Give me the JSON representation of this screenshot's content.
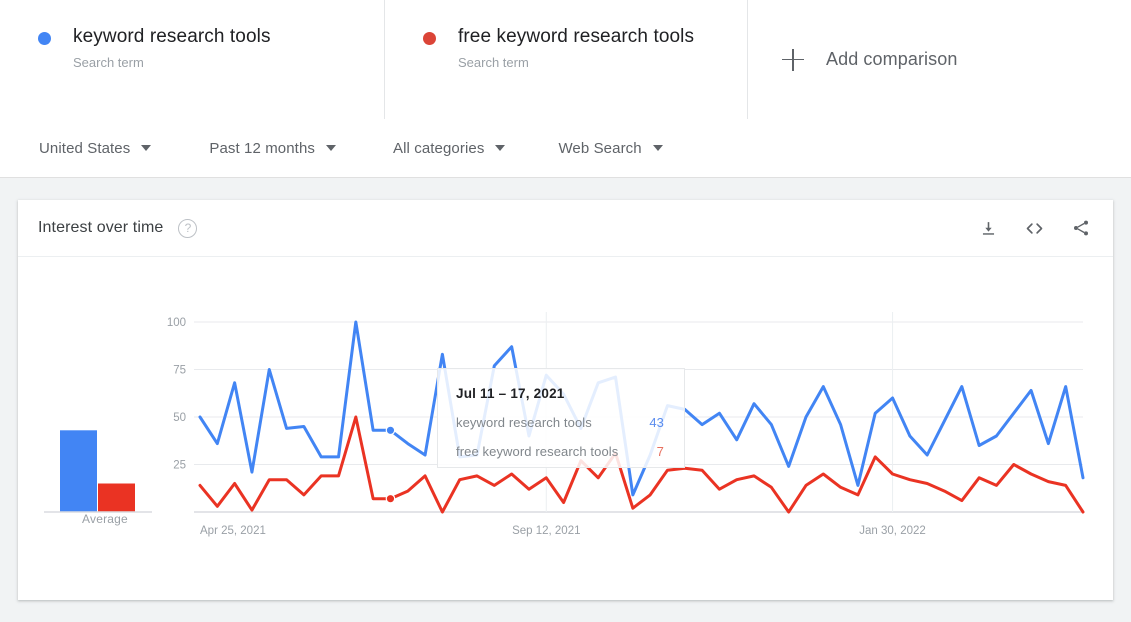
{
  "terms": [
    {
      "label": "keyword research tools",
      "sublabel": "Search term",
      "color": "#4285f4",
      "dot": "blue-dot-icon"
    },
    {
      "label": "free keyword research tools",
      "sublabel": "Search term",
      "color": "#db4437",
      "dot": "red-dot-icon"
    }
  ],
  "add_comparison": {
    "label": "Add comparison",
    "icon": "plus-icon"
  },
  "filters": [
    {
      "label": "United States"
    },
    {
      "label": "Past 12 months"
    },
    {
      "label": "All categories"
    },
    {
      "label": "Web Search"
    }
  ],
  "card": {
    "title": "Interest over time",
    "help_icon": "?",
    "actions": [
      {
        "name": "download-icon"
      },
      {
        "name": "embed-icon"
      },
      {
        "name": "share-icon"
      }
    ]
  },
  "tooltip": {
    "date": "Jul 11 – 17, 2021",
    "rows": [
      {
        "name": "keyword research tools",
        "value": "43",
        "color": "#5b8def"
      },
      {
        "name": "free keyword research tools",
        "value": "7",
        "color": "#e8705f"
      }
    ]
  },
  "average_chart": {
    "label": "Average",
    "values": [
      43,
      15
    ],
    "colors": [
      "#4285f4",
      "#ea3323"
    ]
  },
  "chart_data": {
    "type": "line",
    "title": "Interest over time",
    "xlabel": "",
    "ylabel": "",
    "ylim": [
      0,
      100
    ],
    "yticks": [
      25,
      50,
      75,
      100
    ],
    "ytick_labels": [
      "25",
      "50",
      "75",
      "100"
    ],
    "xtick_labels": [
      "Apr 25, 2021",
      "Sep 12, 2021",
      "Jan 30, 2022"
    ],
    "xtick_index": [
      0,
      20,
      40
    ],
    "grid": true,
    "legend_position": "top",
    "x": [
      "Apr 25, 2021",
      "May 2, 2021",
      "May 9, 2021",
      "May 16, 2021",
      "May 23, 2021",
      "May 30, 2021",
      "Jun 6, 2021",
      "Jun 13, 2021",
      "Jun 20, 2021",
      "Jun 27, 2021",
      "Jul 4, 2021",
      "Jul 11, 2021",
      "Jul 18, 2021",
      "Jul 25, 2021",
      "Aug 1, 2021",
      "Aug 8, 2021",
      "Aug 15, 2021",
      "Aug 22, 2021",
      "Aug 29, 2021",
      "Sep 5, 2021",
      "Sep 12, 2021",
      "Sep 19, 2021",
      "Sep 26, 2021",
      "Oct 3, 2021",
      "Oct 10, 2021",
      "Oct 17, 2021",
      "Oct 24, 2021",
      "Oct 31, 2021",
      "Nov 7, 2021",
      "Nov 14, 2021",
      "Nov 21, 2021",
      "Nov 28, 2021",
      "Dec 5, 2021",
      "Dec 12, 2021",
      "Dec 19, 2021",
      "Dec 26, 2021",
      "Jan 2, 2022",
      "Jan 9, 2022",
      "Jan 16, 2022",
      "Jan 23, 2022",
      "Jan 30, 2022",
      "Feb 6, 2022",
      "Feb 13, 2022",
      "Feb 20, 2022",
      "Feb 27, 2022",
      "Mar 6, 2022",
      "Mar 13, 2022",
      "Mar 20, 2022",
      "Mar 27, 2022",
      "Apr 3, 2022",
      "Apr 10, 2022",
      "Apr 17, 2022"
    ],
    "series": [
      {
        "name": "keyword research tools",
        "color": "#4285f4",
        "values": [
          50,
          36,
          68,
          21,
          75,
          44,
          45,
          29,
          29,
          100,
          43,
          43,
          36,
          30,
          83,
          29,
          30,
          77,
          87,
          40,
          72,
          62,
          44,
          68,
          71,
          9,
          30,
          56,
          54,
          46,
          52,
          38,
          57,
          46,
          24,
          50,
          66,
          46,
          14,
          52,
          60,
          40,
          30,
          48,
          66,
          35,
          40,
          52,
          64,
          36,
          66,
          18
        ]
      },
      {
        "name": "free keyword research tools",
        "color": "#ea3323",
        "values": [
          14,
          3,
          15,
          1,
          17,
          17,
          9,
          19,
          19,
          50,
          7,
          7,
          11,
          19,
          0,
          17,
          19,
          14,
          20,
          12,
          18,
          5,
          27,
          18,
          31,
          2,
          9,
          22,
          23,
          22,
          12,
          17,
          19,
          13,
          0,
          14,
          20,
          13,
          9,
          29,
          20,
          17,
          15,
          11,
          6,
          18,
          14,
          25,
          20,
          16,
          14,
          0
        ]
      }
    ],
    "highlight": {
      "index": 11,
      "date": "Jul 11 – 17, 2021",
      "values": [
        43,
        7
      ]
    }
  }
}
